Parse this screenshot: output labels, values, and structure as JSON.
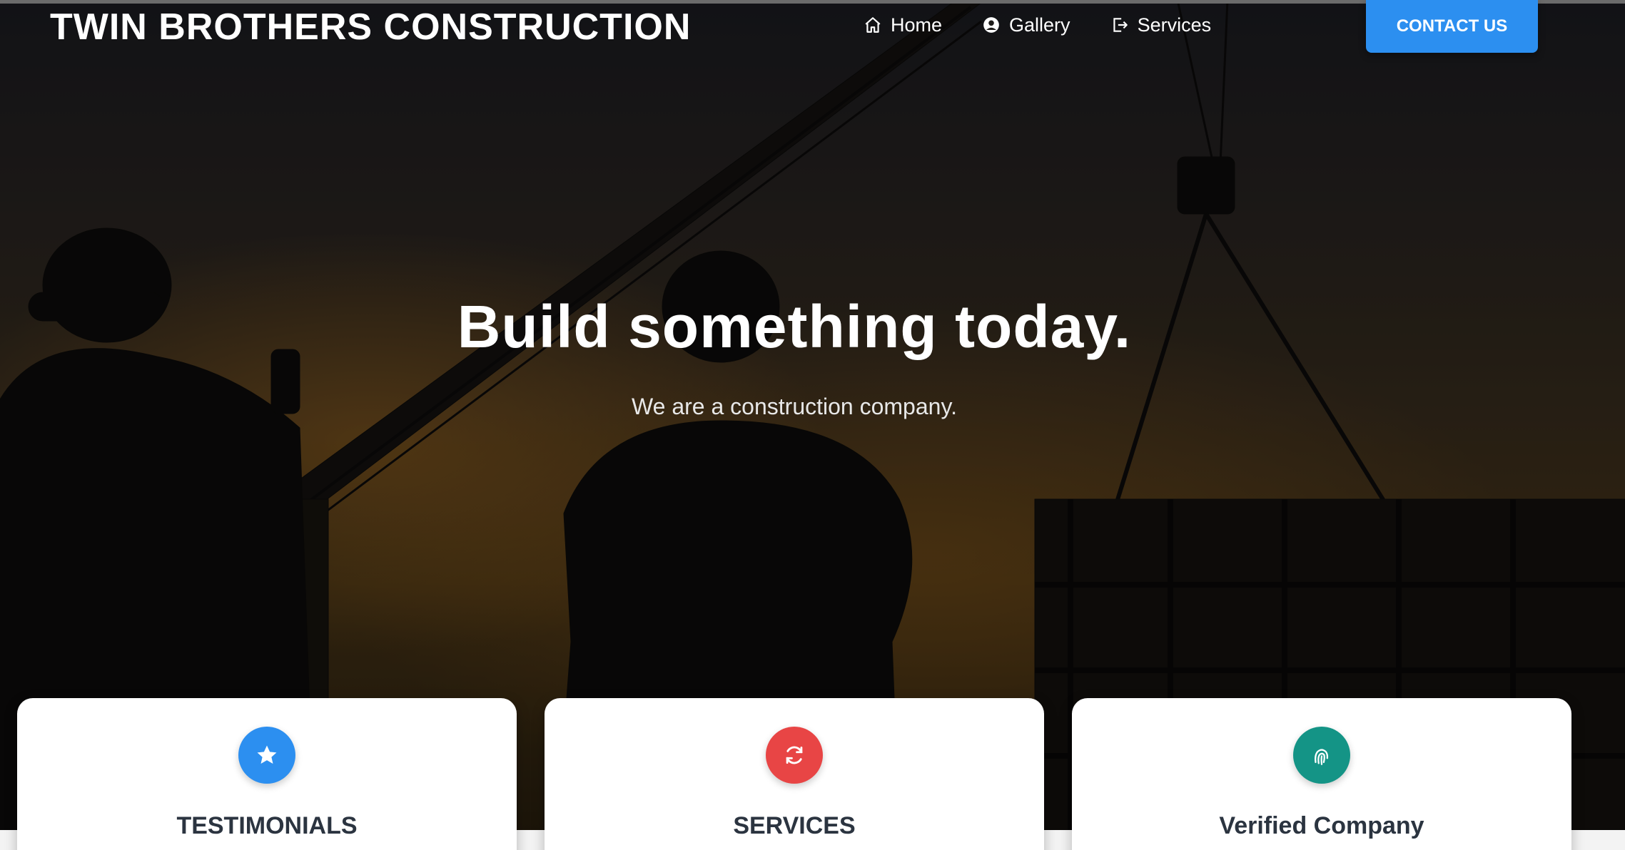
{
  "header": {
    "brand": "TWIN BROTHERS CONSTRUCTION",
    "nav": [
      {
        "label": "Home",
        "icon": "home-icon"
      },
      {
        "label": "Gallery",
        "icon": "user-circle-icon"
      },
      {
        "label": "Services",
        "icon": "sign-out-icon"
      }
    ],
    "contact_label": "CONTACT US",
    "contact_color": "#2c8ff0"
  },
  "hero": {
    "title": "Build something today.",
    "subtitle": "We are a construction company."
  },
  "cards": [
    {
      "title": "TESTIMONIALS",
      "icon": "star-icon",
      "color": "#2c8ff0"
    },
    {
      "title": "SERVICES",
      "icon": "refresh-icon",
      "color": "#e84545"
    },
    {
      "title": "Verified Company",
      "icon": "fingerprint-icon",
      "color": "#149486"
    }
  ]
}
